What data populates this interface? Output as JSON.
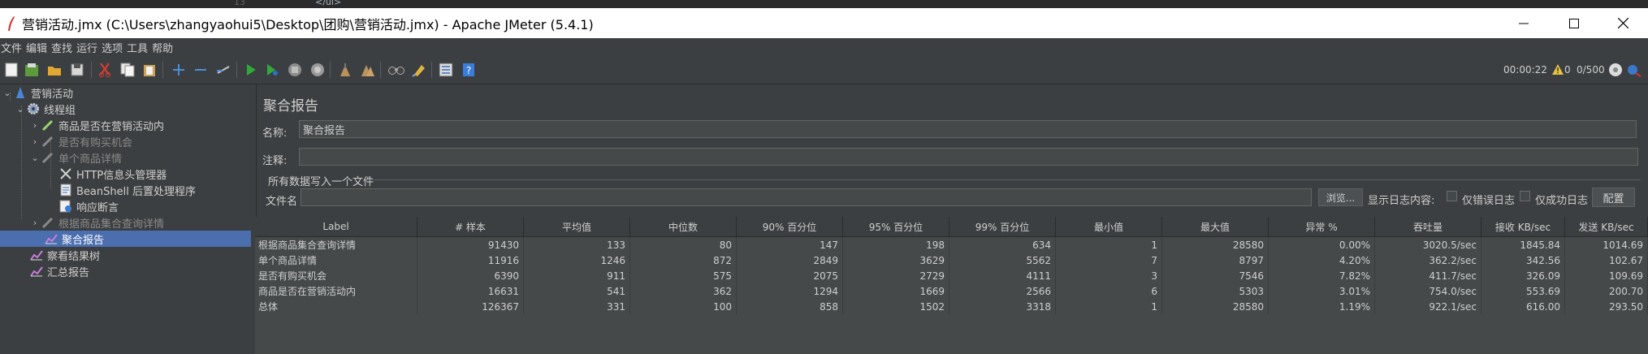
{
  "editor_strip": {
    "line_number": "13",
    "code": "</ul>"
  },
  "window": {
    "title": "营销活动.jmx (C:\\Users\\zhangyaohui5\\Desktop\\团购\\营销活动.jmx) - Apache JMeter (5.4.1)"
  },
  "menu": [
    "文件",
    "编辑",
    "查找",
    "运行",
    "选项",
    "工具",
    "帮助"
  ],
  "toolbar_icons": [
    "new-icon",
    "templates-icon",
    "open-icon",
    "save-icon",
    "cut-icon",
    "copy-icon",
    "paste-icon",
    "expand-icon",
    "collapse-icon",
    "toggle-icon",
    "start-icon",
    "start-no-pause-icon",
    "stop-icon",
    "shutdown-icon",
    "clear-icon",
    "clear-all-icon",
    "search-icon",
    "reset-search-icon",
    "function-helper-icon",
    "help-icon"
  ],
  "status": {
    "elapsed": "00:00:22",
    "warnings": "0",
    "threads": "0/500"
  },
  "tree": {
    "items": [
      {
        "label": "营销活动",
        "icon": "test-plan-icon",
        "disabled": false
      },
      {
        "label": "线程组",
        "icon": "gear-icon",
        "disabled": false
      },
      {
        "label": "商品是否在营销活动内",
        "icon": "sampler-pen-icon",
        "disabled": false
      },
      {
        "label": "是否有购买机会",
        "icon": "sampler-pen-icon",
        "disabled": true
      },
      {
        "label": "单个商品详情",
        "icon": "sampler-pen-icon",
        "disabled": true
      },
      {
        "label": "HTTP信息头管理器",
        "icon": "tools-icon",
        "disabled": false
      },
      {
        "label": "BeanShell 后置处理程序",
        "icon": "document-icon",
        "disabled": false
      },
      {
        "label": "响应断言",
        "icon": "assertion-icon",
        "disabled": false
      },
      {
        "label": "根据商品集合查询详情",
        "icon": "sampler-pen-icon",
        "disabled": true
      },
      {
        "label": "聚合报告",
        "icon": "chart-icon",
        "disabled": false
      },
      {
        "label": "察看结果树",
        "icon": "chart-icon",
        "disabled": false
      },
      {
        "label": "汇总报告",
        "icon": "chart-icon",
        "disabled": false
      }
    ]
  },
  "panel": {
    "title": "聚合报告",
    "name_label": "名称:",
    "name_value": "聚合报告",
    "comment_label": "注释:",
    "comment_value": "",
    "file_group_title": "所有数据写入一个文件",
    "file_label": "文件名",
    "file_value": "",
    "browse_button": "浏览...",
    "log_display_label": "显示日志内容:",
    "errors_only_label": "仅错误日志",
    "success_only_label": "仅成功日志",
    "configure_button": "配置"
  },
  "table": {
    "headers": [
      "Label",
      "# 样本",
      "平均值",
      "中位数",
      "90% 百分位",
      "95% 百分位",
      "99% 百分位",
      "最小值",
      "最大值",
      "异常 %",
      "吞吐量",
      "接收 KB/sec",
      "发送 KB/sec"
    ],
    "rows": [
      [
        "根据商品集合查询详情",
        "91430",
        "133",
        "80",
        "147",
        "198",
        "634",
        "1",
        "28580",
        "0.00%",
        "3020.5/sec",
        "1845.84",
        "1014.69"
      ],
      [
        "单个商品详情",
        "11916",
        "1246",
        "872",
        "2849",
        "3629",
        "5562",
        "7",
        "8797",
        "4.20%",
        "362.2/sec",
        "342.56",
        "102.67"
      ],
      [
        "是否有购买机会",
        "6390",
        "911",
        "575",
        "2075",
        "2729",
        "4111",
        "3",
        "7546",
        "7.82%",
        "411.7/sec",
        "326.09",
        "109.69"
      ],
      [
        "商品是否在营销活动内",
        "16631",
        "541",
        "362",
        "1294",
        "1669",
        "2566",
        "6",
        "5303",
        "3.01%",
        "754.0/sec",
        "553.69",
        "200.70"
      ],
      [
        "总体",
        "126367",
        "331",
        "100",
        "858",
        "1502",
        "3318",
        "1",
        "28580",
        "1.19%",
        "922.1/sec",
        "616.00",
        "293.50"
      ]
    ]
  }
}
